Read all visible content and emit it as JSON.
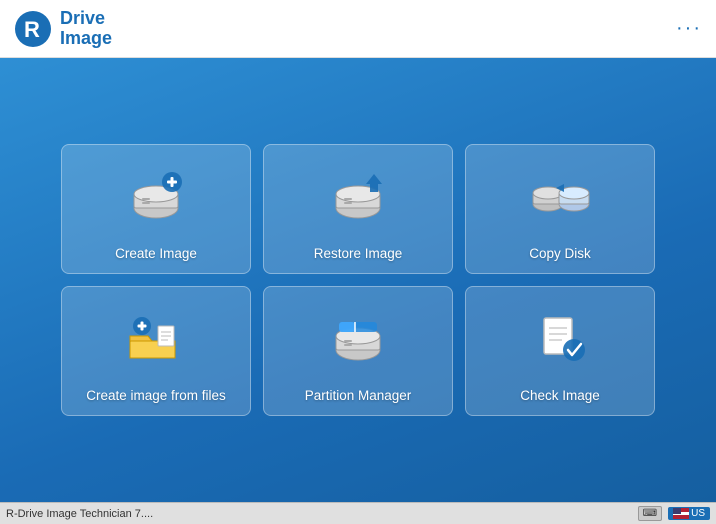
{
  "header": {
    "title_line1": "Drive",
    "title_line2": "Image",
    "menu_dots": "···"
  },
  "tiles": [
    {
      "id": "create-image",
      "label": "Create Image",
      "icon": "create-image-icon"
    },
    {
      "id": "restore-image",
      "label": "Restore Image",
      "icon": "restore-image-icon"
    },
    {
      "id": "copy-disk",
      "label": "Copy Disk",
      "icon": "copy-disk-icon"
    },
    {
      "id": "create-image-files",
      "label": "Create image from files",
      "icon": "create-image-files-icon"
    },
    {
      "id": "partition-manager",
      "label": "Partition Manager",
      "icon": "partition-manager-icon"
    },
    {
      "id": "check-image",
      "label": "Check Image",
      "icon": "check-image-icon"
    }
  ],
  "statusbar": {
    "app_name": "R-Drive Image Technician 7....",
    "keyboard_label": "⌨",
    "lang": "US"
  }
}
